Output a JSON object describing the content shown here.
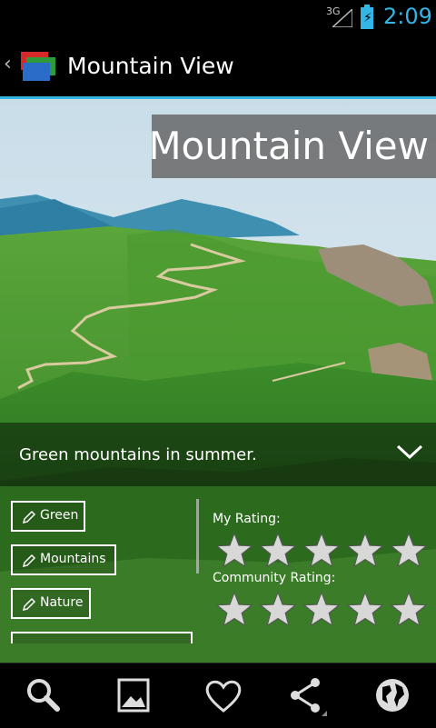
{
  "status_bar": {
    "network": "3G",
    "time": "2:09"
  },
  "action_bar": {
    "title": "Mountain View"
  },
  "photo": {
    "title": "Mountain View",
    "caption": "Green mountains in summer."
  },
  "tags": [
    {
      "label": "Green"
    },
    {
      "label": "Mountains"
    },
    {
      "label": "Nature"
    }
  ],
  "ratings": {
    "my_label": "My Rating:",
    "my_value": 0,
    "community_label": "Community Rating:",
    "community_value": 0,
    "max": 5
  },
  "bottom_bar": {
    "buttons": [
      "search-icon",
      "image-icon",
      "heart-icon",
      "share-icon",
      "globe-icon"
    ]
  }
}
